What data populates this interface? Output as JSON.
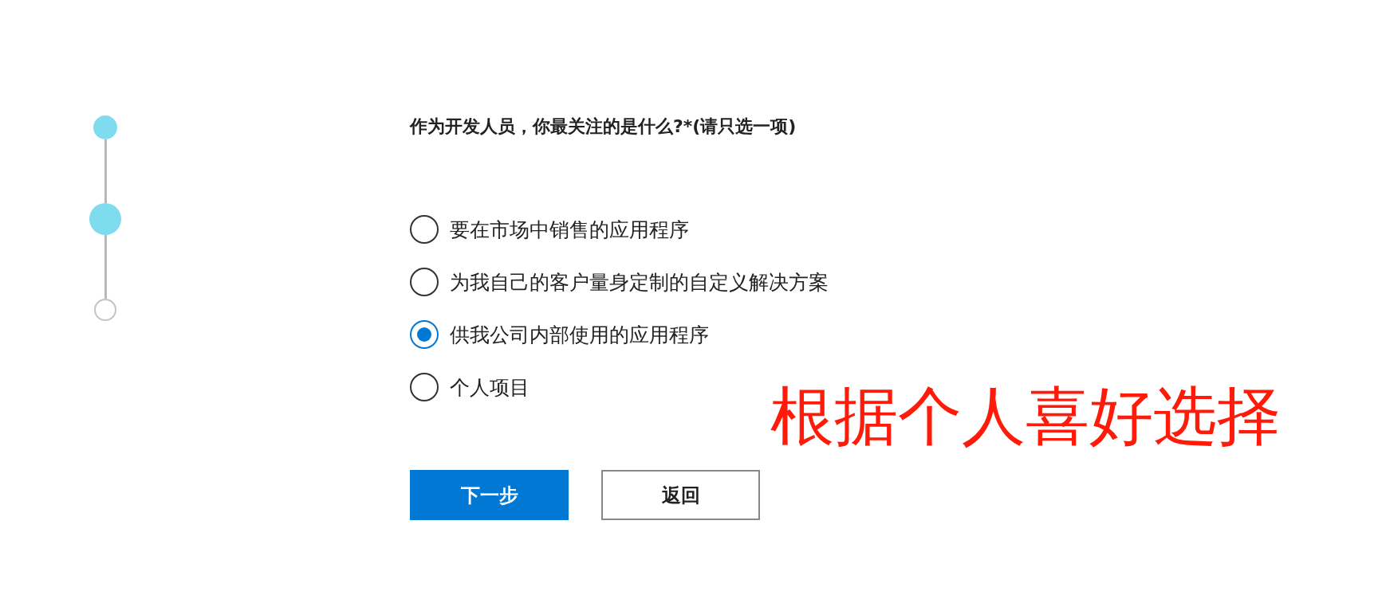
{
  "steps": [
    {
      "completed": true,
      "current": false
    },
    {
      "completed": true,
      "current": true
    },
    {
      "completed": false,
      "current": false
    }
  ],
  "question": "作为开发人员，你最关注的是什么?*(请只选一项)",
  "options": [
    {
      "label": "要在市场中销售的应用程序",
      "selected": false
    },
    {
      "label": "为我自己的客户量身定制的自定义解决方案",
      "selected": false
    },
    {
      "label": "供我公司内部使用的应用程序",
      "selected": true
    },
    {
      "label": "个人项目",
      "selected": false
    }
  ],
  "buttons": [
    {
      "label": "下一步",
      "kind": "primary"
    },
    {
      "label": "返回",
      "kind": "secondary"
    }
  ],
  "annotation": "根据个人喜好选择"
}
